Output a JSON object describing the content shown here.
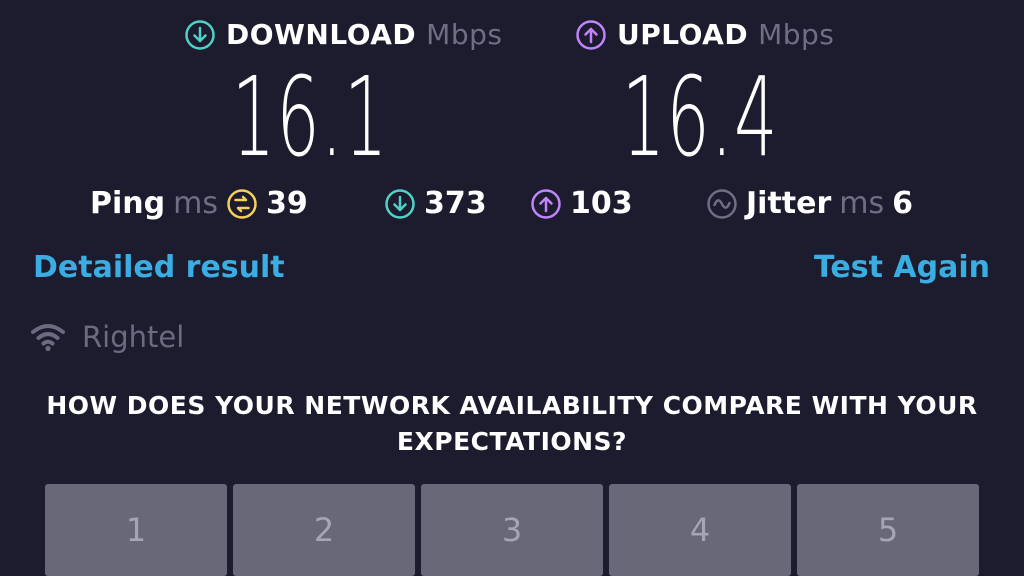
{
  "download": {
    "label": "DOWNLOAD",
    "unit": "Mbps",
    "value": "16.1",
    "icon": "arrow-down-circle-icon",
    "color": "#4fd1c5"
  },
  "upload": {
    "label": "UPLOAD",
    "unit": "Mbps",
    "value": "16.4",
    "icon": "arrow-up-circle-icon",
    "color": "#c084fc"
  },
  "ping": {
    "label": "Ping",
    "unit": "ms",
    "value": "39",
    "icon": "ping-circle-icon",
    "color": "#f5d05c"
  },
  "download_latency": {
    "value": "373",
    "icon": "arrow-down-circle-icon"
  },
  "upload_latency": {
    "value": "103",
    "icon": "arrow-up-circle-icon"
  },
  "jitter": {
    "label": "Jitter",
    "unit": "ms",
    "value": "6",
    "icon": "wave-circle-icon",
    "color": "#6e6e85"
  },
  "actions": {
    "detailed": "Detailed result",
    "test_again": "Test Again"
  },
  "provider": {
    "name": "Rightel",
    "icon": "wifi-icon"
  },
  "survey": {
    "question": "HOW DOES YOUR NETWORK AVAILABILITY COMPARE WITH YOUR EXPECTATIONS?",
    "options": [
      "1",
      "2",
      "3",
      "4",
      "5"
    ]
  }
}
